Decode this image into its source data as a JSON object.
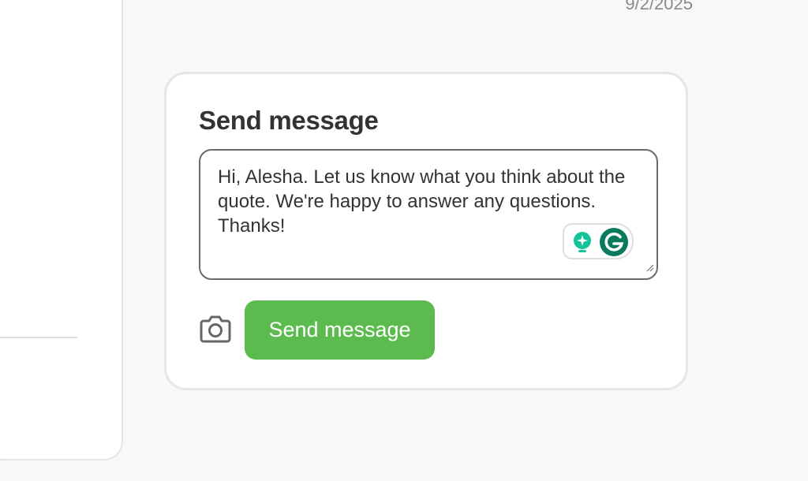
{
  "header": {
    "date": "9/2/2025"
  },
  "composer": {
    "title": "Send message",
    "message": "Hi, Alesha. Let us know what you think about the quote. We're happy to answer any questions. Thanks!",
    "send_label": "Send message"
  },
  "icons": {
    "camera": "camera-icon",
    "grammarly_assist": "lightbulb-sparkle-icon",
    "grammarly": "grammarly-g-icon",
    "resize": "resize-handle-icon"
  },
  "colors": {
    "send_button": "#5cbb4e",
    "grammarly_teal": "#15c39a",
    "grammarly_dark": "#0b7a5c"
  }
}
